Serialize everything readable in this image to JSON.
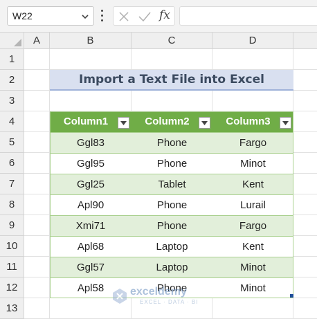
{
  "formula_bar": {
    "name_box": "W22",
    "fx_label": "fx",
    "formula": ""
  },
  "columns": [
    "A",
    "B",
    "C",
    "D"
  ],
  "rows": [
    "1",
    "2",
    "3",
    "4",
    "5",
    "6",
    "7",
    "8",
    "9",
    "10",
    "11",
    "12",
    "13"
  ],
  "title": "Import a Text File into Excel",
  "table": {
    "headers": [
      "Column1",
      "Column2",
      "Column3"
    ],
    "rows": [
      [
        "Ggl83",
        "Phone",
        "Fargo"
      ],
      [
        "Ggl95",
        "Phone",
        "Minot"
      ],
      [
        "Ggl25",
        "Tablet",
        "Kent"
      ],
      [
        "Apl90",
        "Phone",
        "Lurail"
      ],
      [
        "Xmi71",
        "Phone",
        "Fargo"
      ],
      [
        "Apl68",
        "Laptop",
        "Kent"
      ],
      [
        "Ggl57",
        "Laptop",
        "Minot"
      ],
      [
        "Apl58",
        "Phone",
        "Minot"
      ]
    ]
  },
  "watermark": {
    "brand": "exceldemy",
    "tagline": "EXCEL · DATA · BI"
  },
  "colors": {
    "table_header": "#70ad47",
    "band": "#e2efda",
    "title_fill": "#d9e0f0"
  }
}
